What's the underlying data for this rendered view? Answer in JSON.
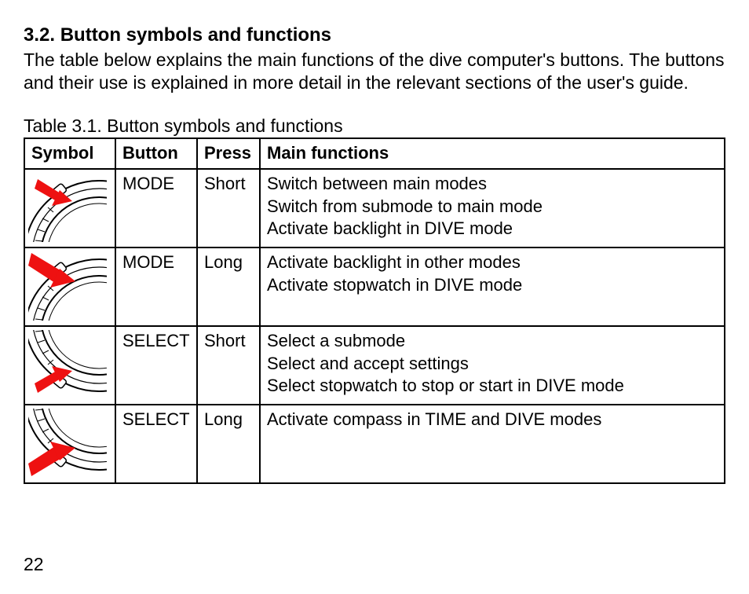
{
  "section_number": "3.2.",
  "section_title": "Button symbols and functions",
  "intro_text": "The table below explains the main functions of the dive computer's buttons. The buttons and their use is explained in more detail in the relevant sections of the user's guide.",
  "table_caption": "Table 3.1.  Button symbols and functions",
  "headers": {
    "symbol": "Symbol",
    "button": "Button",
    "press": "Press",
    "main_functions": "Main functions"
  },
  "rows": [
    {
      "button": "MODE",
      "press": "Short",
      "functions": [
        "Switch between main modes",
        "Switch from submode to main mode",
        "Activate backlight in DIVE mode"
      ]
    },
    {
      "button": "MODE",
      "press": "Long",
      "functions": [
        "Activate backlight in other modes",
        "Activate stopwatch in DIVE mode"
      ]
    },
    {
      "button": "SELECT",
      "press": "Short",
      "functions": [
        "Select a submode",
        "Select and accept settings",
        "Select stopwatch to stop or start in DIVE mode"
      ]
    },
    {
      "button": "SELECT",
      "press": "Long",
      "functions": [
        "Activate compass in TIME and DIVE modes"
      ]
    }
  ],
  "page_number": "22"
}
